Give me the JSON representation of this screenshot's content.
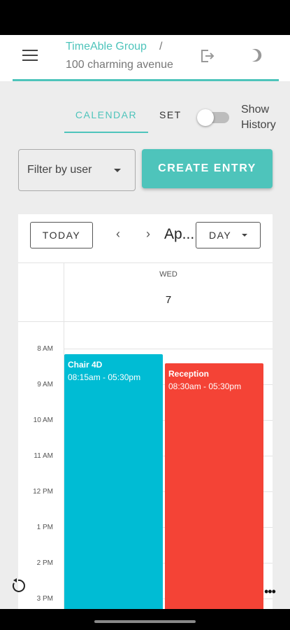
{
  "header": {
    "brand": "TimeAble Group",
    "separator": "/",
    "address": "100 charming avenue",
    "icons": {
      "menu": "menu-icon",
      "logout": "logout-icon",
      "theme": "moon-icon"
    }
  },
  "tabs": [
    {
      "label": "CALENDAR",
      "active": true
    },
    {
      "label": "SET",
      "active": false
    }
  ],
  "show_history": {
    "label": "Show History",
    "checked": false
  },
  "filter": {
    "label": "Filter by user",
    "icon": "chevron-down-icon"
  },
  "create_button": {
    "label": "CREATE ENTRY"
  },
  "calendar": {
    "today_label": "TODAY",
    "prev_icon": "‹",
    "next_icon": "›",
    "month_label": "Ap...",
    "view_label": "DAY",
    "day_name": "WED",
    "day_number": "7",
    "times": [
      "8 AM",
      "9 AM",
      "10 AM",
      "11 AM",
      "12 PM",
      "1 PM",
      "2 PM",
      "3 PM"
    ],
    "events": [
      {
        "title": "Chair 4D",
        "time": "08:15am - 05:30pm",
        "color": "#00bcd4"
      },
      {
        "title": "Reception",
        "time": "08:30am - 05:30pm",
        "color": "#f44336"
      }
    ]
  },
  "footer": {
    "refresh_icon": "refresh-icon",
    "more_icon": "more-horizontal-icon"
  },
  "colors": {
    "accent": "#4ec4bb",
    "background": "#ededed"
  }
}
